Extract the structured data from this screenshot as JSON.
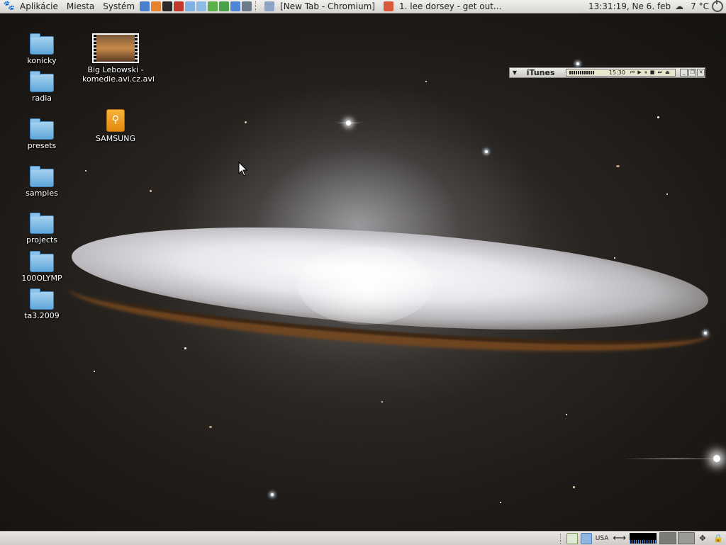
{
  "top_panel": {
    "menus": [
      "Aplikácie",
      "Miesta",
      "Systém"
    ],
    "launchers": [
      {
        "icon": "chromium-icon",
        "color": "#4a7fd0"
      },
      {
        "icon": "firefox-icon",
        "color": "#e8822d"
      },
      {
        "icon": "terminal-icon",
        "color": "#2a2a2a"
      },
      {
        "icon": "pdf-reader-icon",
        "color": "#c0392b"
      },
      {
        "icon": "file-manager-icon",
        "color": "#7fb2e3"
      },
      {
        "icon": "folder-icon",
        "color": "#8fbbe3"
      },
      {
        "icon": "utility-icon",
        "color": "#5bb04b"
      },
      {
        "icon": "network-icon",
        "color": "#49a24a"
      },
      {
        "icon": "music-icon",
        "color": "#4f86d8"
      },
      {
        "icon": "notes-icon",
        "color": "#6b7b8a"
      }
    ],
    "tasks": [
      {
        "label": "[New Tab - Chromium]",
        "icon": "chromium-icon",
        "color": "#8fa4c4"
      },
      {
        "label": "1. lee dorsey - get out...",
        "icon": "media-player-icon",
        "color": "#d95a3a"
      }
    ],
    "clock": "13:31:19, Ne  6. feb",
    "temperature": "7 °C"
  },
  "desktop_icons": [
    {
      "label": "konicky",
      "type": "folder"
    },
    {
      "label": "radia",
      "type": "folder"
    },
    {
      "label": "presets",
      "type": "folder"
    },
    {
      "label": "samples",
      "type": "folder"
    },
    {
      "label": "projects",
      "type": "folder"
    },
    {
      "label": "100OLYMP",
      "type": "folder"
    },
    {
      "label": "ta3.2009",
      "type": "folder"
    },
    {
      "label": "Big Lebowski - komedie.avi.cz.avi",
      "type": "video"
    },
    {
      "label": "SAMSUNG",
      "type": "usb-drive"
    }
  ],
  "itunes": {
    "title": "iTunes",
    "time": "15:30",
    "controls": "⏮ ▶ ⏸ ■ ⏭ ⏏"
  },
  "bottom_panel": {
    "keyboard_layout": "USA"
  }
}
